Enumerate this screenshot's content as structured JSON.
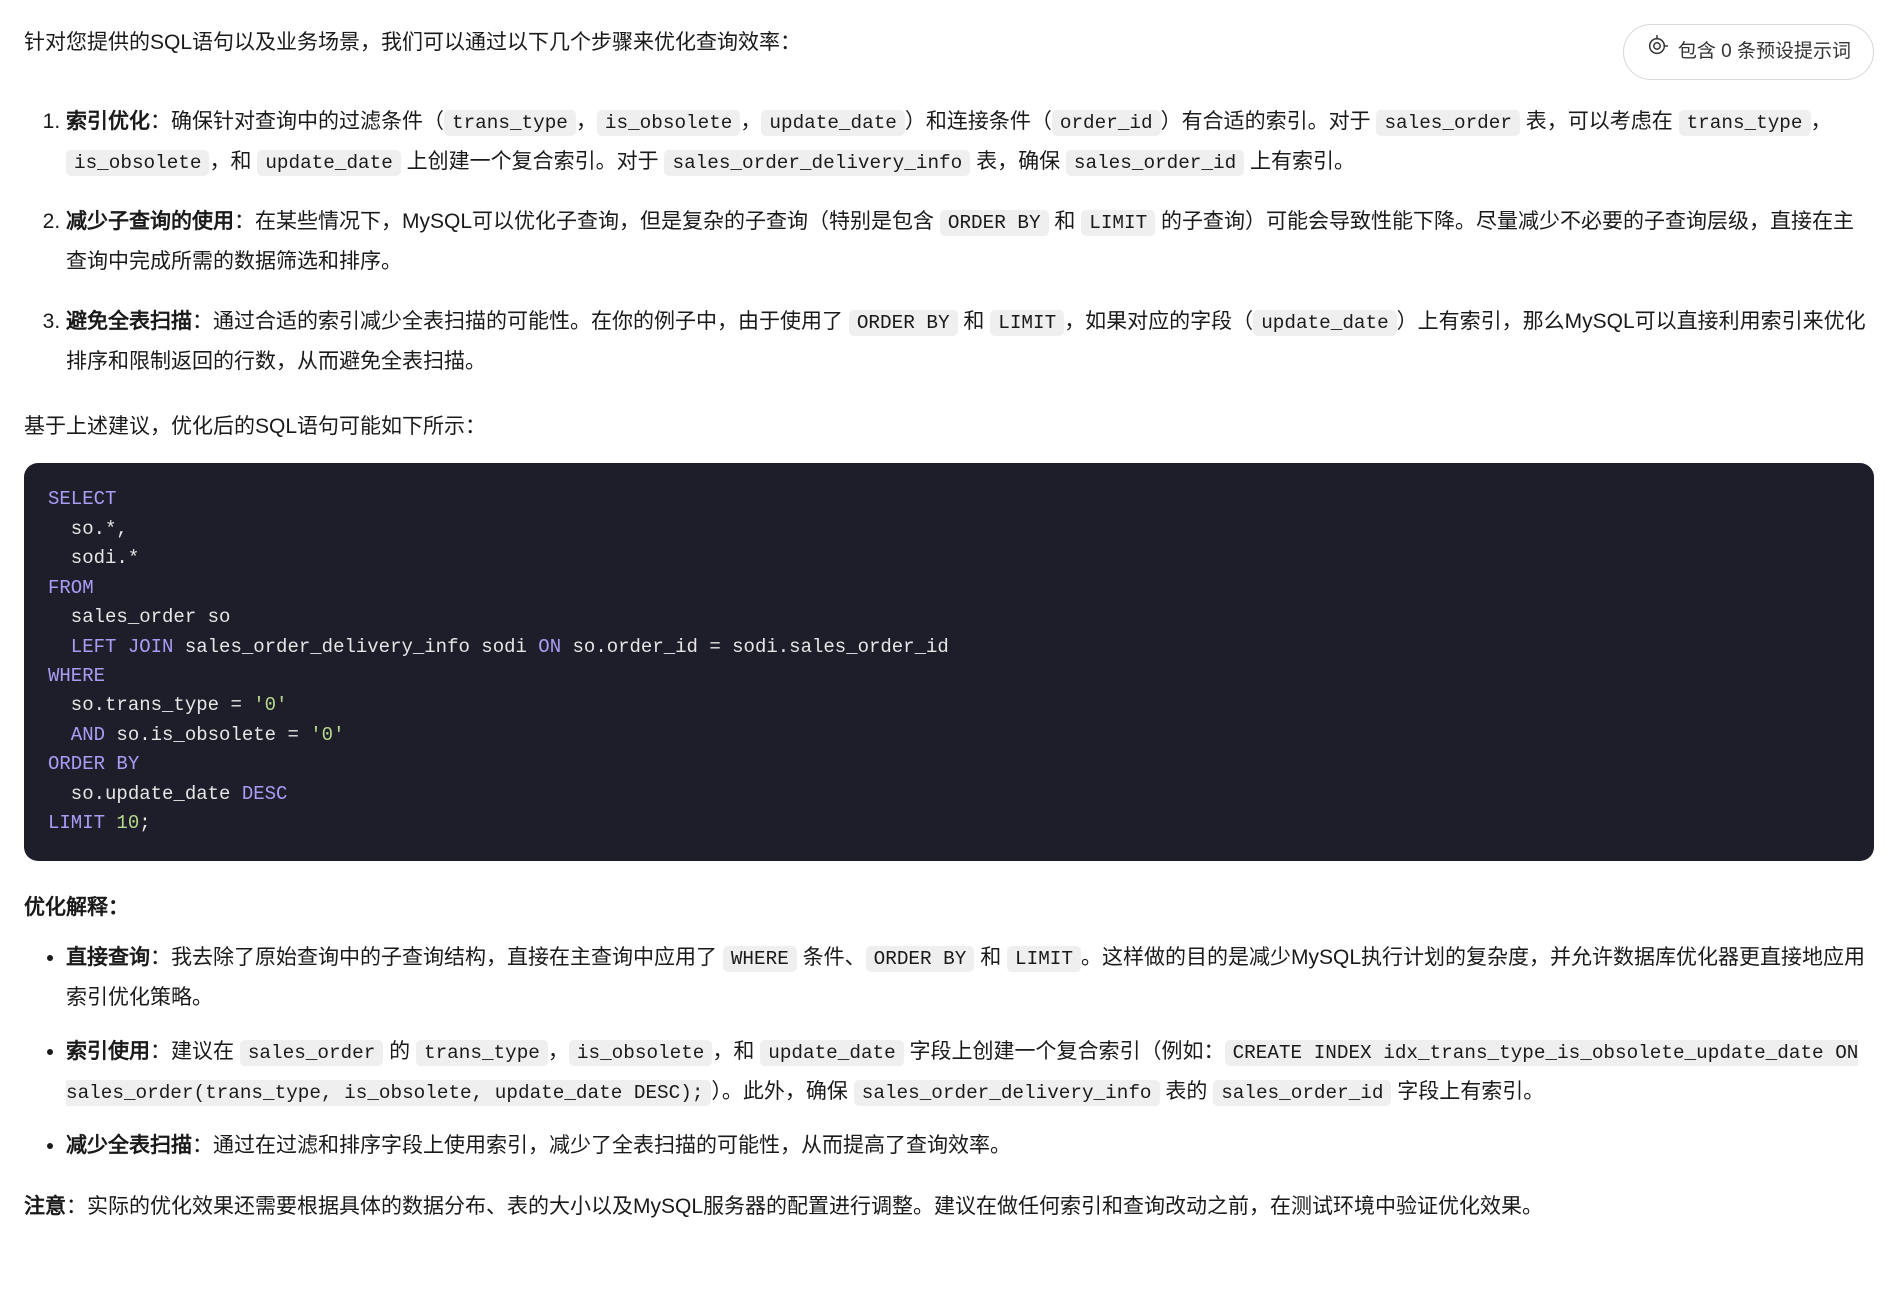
{
  "pill": {
    "label": "包含 0 条预设提示词"
  },
  "intro": "针对您提供的SQL语句以及业务场景，我们可以通过以下几个步骤来优化查询效率：",
  "list1": {
    "i1": {
      "title": "索引优化",
      "t1": "：确保针对查询中的过滤条件（",
      "c1": "trans_type",
      "t2": "，",
      "c2": "is_obsolete",
      "t3": "，",
      "c3": "update_date",
      "t4": "）和连接条件（",
      "c4": "order_id",
      "t5": "）有合适的索引。对于 ",
      "c5": "sales_order",
      "t6": " 表，可以考虑在 ",
      "c6": "trans_type",
      "t7": "，",
      "c7": "is_obsolete",
      "t8": "，和 ",
      "c8": "update_date",
      "t9": " 上创建一个复合索引。对于 ",
      "c9": "sales_order_delivery_info",
      "t10": " 表，确保 ",
      "c10": "sales_order_id",
      "t11": " 上有索引。"
    },
    "i2": {
      "title": "减少子查询的使用",
      "t1": "：在某些情况下，MySQL可以优化子查询，但是复杂的子查询（特别是包含 ",
      "c1": "ORDER BY",
      "t2": " 和 ",
      "c2": "LIMIT",
      "t3": " 的子查询）可能会导致性能下降。尽量减少不必要的子查询层级，直接在主查询中完成所需的数据筛选和排序。"
    },
    "i3": {
      "title": "避免全表扫描",
      "t1": "：通过合适的索引减少全表扫描的可能性。在你的例子中，由于使用了 ",
      "c1": "ORDER BY",
      "t2": " 和 ",
      "c2": "LIMIT",
      "t3": "，如果对应的字段（",
      "c3": "update_date",
      "t4": "）上有索引，那么MySQL可以直接利用索引来优化排序和限制返回的行数，从而避免全表扫描。"
    }
  },
  "based_on": "基于上述建议，优化后的SQL语句可能如下所示：",
  "sql": {
    "l1a": "SELECT",
    "l2": "  so.",
    "l2b": "*",
    "l2c": ",",
    "l3": "  sodi.",
    "l3b": "*",
    "l4a": "FROM",
    "l5": "  sales_order so",
    "l6a": "  LEFT",
    "l6b": " JOIN",
    "l6c": " sales_order_delivery_info sodi ",
    "l6d": "ON",
    "l6e": " so.order_id ",
    "l6f": "=",
    "l6g": " sodi.sales_order_id",
    "l7a": "WHERE",
    "l8a": "  so.trans_type ",
    "l8b": "=",
    "l8c": " ",
    "l8d": "'0'",
    "l9a": "  AND",
    "l9b": " so.is_obsolete ",
    "l9c": "=",
    "l9d": " ",
    "l9e": "'0'",
    "l10a": "ORDER",
    "l10b": " BY",
    "l11a": "  so.update_date ",
    "l11b": "DESC",
    "l12a": "LIMIT ",
    "l12b": "10",
    "l12c": ";"
  },
  "opt_title": "优化解释：",
  "list2": {
    "i1": {
      "title": "直接查询",
      "t1": "：我去除了原始查询中的子查询结构，直接在主查询中应用了 ",
      "c1": "WHERE",
      "t2": " 条件、",
      "c2": "ORDER BY",
      "t3": " 和 ",
      "c3": "LIMIT",
      "t4": "。这样做的目的是减少MySQL执行计划的复杂度，并允许数据库优化器更直接地应用索引优化策略。"
    },
    "i2": {
      "title": "索引使用",
      "t1": "：建议在 ",
      "c1": "sales_order",
      "t2": " 的 ",
      "c2": "trans_type",
      "t3": "，",
      "c3": "is_obsolete",
      "t4": "，和 ",
      "c4": "update_date",
      "t5": " 字段上创建一个复合索引（例如：",
      "c5": "CREATE INDEX idx_trans_type_is_obsolete_update_date ON sales_order(trans_type, is_obsolete, update_date DESC);",
      "t6": "）。此外，确保 ",
      "c6": "sales_order_delivery_info",
      "t7": " 表的 ",
      "c7": "sales_order_id",
      "t8": " 字段上有索引。"
    },
    "i3": {
      "title": "减少全表扫描",
      "t1": "：通过在过滤和排序字段上使用索引，减少了全表扫描的可能性，从而提高了查询效率。"
    }
  },
  "note": {
    "title": "注意",
    "body": "：实际的优化效果还需要根据具体的数据分布、表的大小以及MySQL服务器的配置进行调整。建议在做任何索引和查询改动之前，在测试环境中验证优化效果。"
  }
}
